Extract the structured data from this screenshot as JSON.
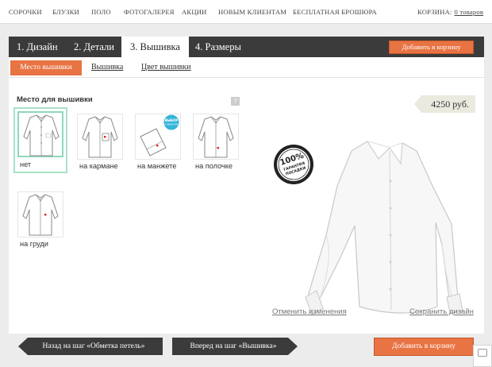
{
  "topnav": {
    "items": [
      {
        "label": "СОРОЧКИ"
      },
      {
        "label": "БЛУЗКИ"
      },
      {
        "label": "ПОЛО"
      },
      {
        "label": "ФОТОГАЛЕРЕЯ"
      },
      {
        "label": "АКЦИИ"
      },
      {
        "label": "НОВЫМ КЛИЕНТАМ"
      },
      {
        "label": "БЕСПЛАТНАЯ БРОШЮРА"
      }
    ],
    "cart_label": "КОРЗИНА:",
    "cart_link": "0 товаров"
  },
  "steps": [
    {
      "label": "1. Дизайн"
    },
    {
      "label": "2. Детали"
    },
    {
      "label": "3. Вышивка",
      "active": true
    },
    {
      "label": "4. Размеры"
    }
  ],
  "add_to_cart_top": "Добавить в корзину",
  "subtabs": [
    {
      "label": "Место вышивки",
      "active": true
    },
    {
      "label": "Вышивка"
    },
    {
      "label": "Цвет вышивки"
    }
  ],
  "placement": {
    "title": "Место для вышивки",
    "help": "?",
    "options": [
      {
        "label": "нет",
        "selected": true
      },
      {
        "label": "на кармане"
      },
      {
        "label": "на манжете",
        "badge": "ВЫБОР КЛИЕНТОВ"
      },
      {
        "label": "на полочке"
      },
      {
        "label": "на груди"
      }
    ]
  },
  "price": "4250 руб.",
  "guarantee_badge": {
    "line1": "100%",
    "line2": "ГАРАНТИЯ",
    "line3": "ПОСАДКИ"
  },
  "links": {
    "cancel": "Отменить изменения",
    "save": "Сохранить дизайн"
  },
  "nav_buttons": {
    "back": "Назад на шаг «Обметка петель»",
    "next": "Вперед на шаг «Вышивка»",
    "add_to_cart": "Добавить в корзину"
  },
  "colors": {
    "accent": "#e87343",
    "dark": "#3b3b3b",
    "selected_border": "#a9e2c7"
  }
}
